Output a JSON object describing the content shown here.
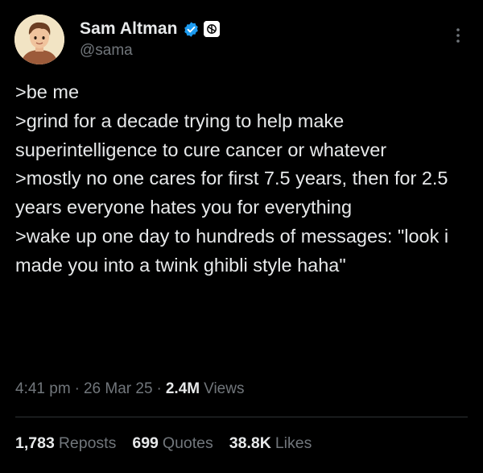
{
  "author": {
    "display_name": "Sam Altman",
    "handle": "@sama",
    "avatar": "avatar-cartoon-portrait",
    "verified_icon": "verified-badge-icon",
    "affiliate_icon": "openai-logo-icon"
  },
  "tweet": {
    "lines": [
      ">be me",
      ">grind for a decade trying to help make superintelligence to cure cancer or whatever",
      ">mostly no one cares for first 7.5 years, then for 2.5 years everyone hates you for everything",
      ">wake up one day to hundreds of messages: \"look i made you into a twink ghibli style haha\""
    ]
  },
  "meta": {
    "time": "4:41 pm",
    "date": "26 Mar 25",
    "separator": "·",
    "views_count": "2.4M",
    "views_label": "Views"
  },
  "stats": {
    "reposts_count": "1,783",
    "reposts_label": "Reposts",
    "quotes_count": "699",
    "quotes_label": "Quotes",
    "likes_count": "38.8K",
    "likes_label": "Likes"
  },
  "colors": {
    "background": "#000000",
    "primary_text": "#e7e9ea",
    "secondary_text": "#71767b",
    "verified_blue": "#1d9bf0",
    "divider": "#2f3336"
  }
}
